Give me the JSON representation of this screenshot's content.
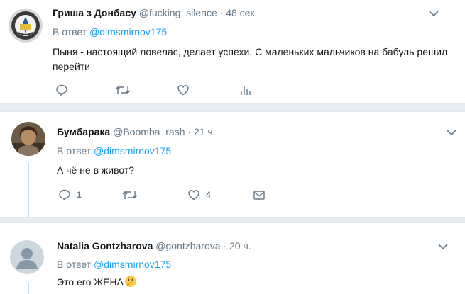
{
  "tweets": [
    {
      "name": "Гриша з Донбасу",
      "handle": "@fucking_silence",
      "sep": "·",
      "time": "48 сек.",
      "reply_prefix": "В ответ",
      "reply_to": "@dimsmirnov175",
      "text": "Пыня - настоящий ловелас, делает успехи. С маленьких мальчиков на бабуль решил перейти",
      "reply_count": "",
      "like_count": "",
      "fourth_action": "analytics-icon"
    },
    {
      "name": "Бумбарака",
      "handle": "@Boomba_rash",
      "sep": "·",
      "time": "21 ч.",
      "reply_prefix": "В ответ",
      "reply_to": "@dimsmirnov175",
      "text": "А чё не в живот?",
      "reply_count": "1",
      "like_count": "4",
      "fourth_action": "envelope-icon"
    },
    {
      "name": "Natalia Gontzharova",
      "handle": "@gontzharova",
      "sep": "·",
      "time": "20 ч.",
      "reply_prefix": "В ответ",
      "reply_to": "@dimsmirnov175",
      "text": "Это его ЖЕНА",
      "emoji": "thinking-face-emoji"
    }
  ],
  "colors": {
    "link": "#1da1f2",
    "secondary": "#657786",
    "thread_line": "#c4e1f5",
    "background": "#e6ecf0"
  }
}
